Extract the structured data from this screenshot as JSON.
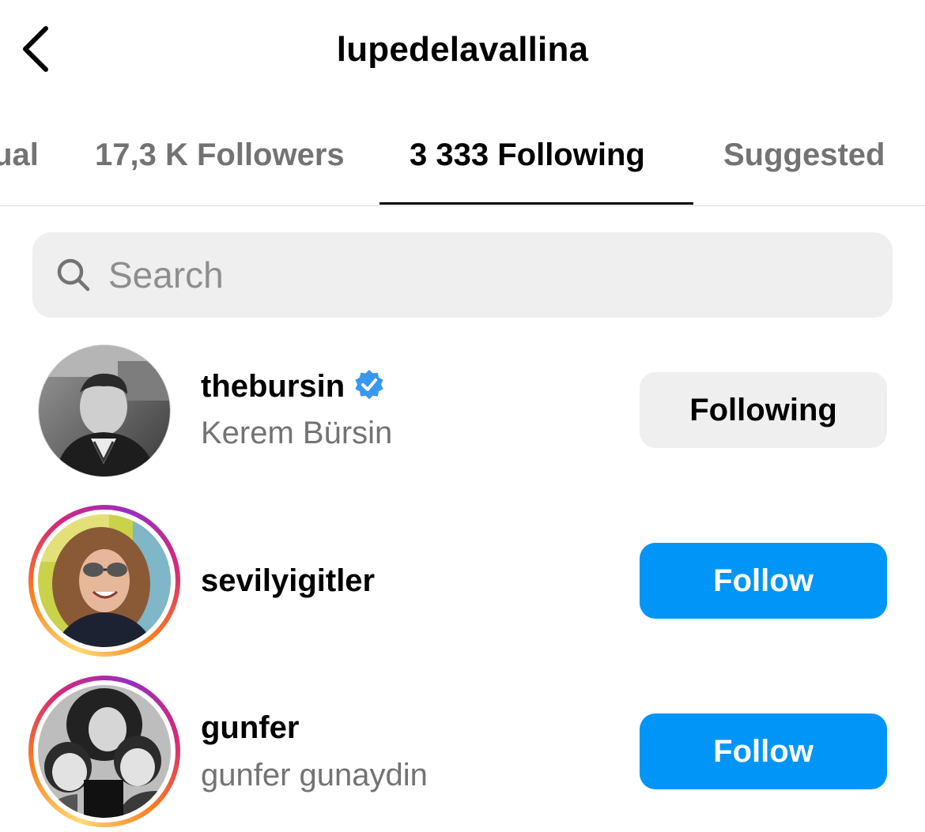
{
  "header": {
    "title": "lupedelavallina",
    "back_icon": "chevron-left-icon"
  },
  "tabs": [
    {
      "label": "Mutual",
      "active": false
    },
    {
      "label": "17,3 K Followers",
      "active": false
    },
    {
      "label": "3 333 Following",
      "active": true
    },
    {
      "label": "Suggested",
      "active": false
    }
  ],
  "search": {
    "placeholder": "Search",
    "value": "",
    "icon": "search-icon"
  },
  "accounts": [
    {
      "username": "thebursin",
      "full_name": "Kerem Bürsin",
      "verified": true,
      "has_story_ring": false,
      "button_label": "Following",
      "button_state": "following"
    },
    {
      "username": "sevilyigitler",
      "full_name": "",
      "verified": false,
      "has_story_ring": true,
      "button_label": "Follow",
      "button_state": "follow"
    },
    {
      "username": "gunfer",
      "full_name": "gunfer gunaydin",
      "verified": false,
      "has_story_ring": true,
      "button_label": "Follow",
      "button_state": "follow"
    }
  ],
  "colors": {
    "follow_button": "#0095f6",
    "following_button": "#efefef",
    "verified_badge": "#3897f0",
    "secondary_text": "#737373"
  }
}
